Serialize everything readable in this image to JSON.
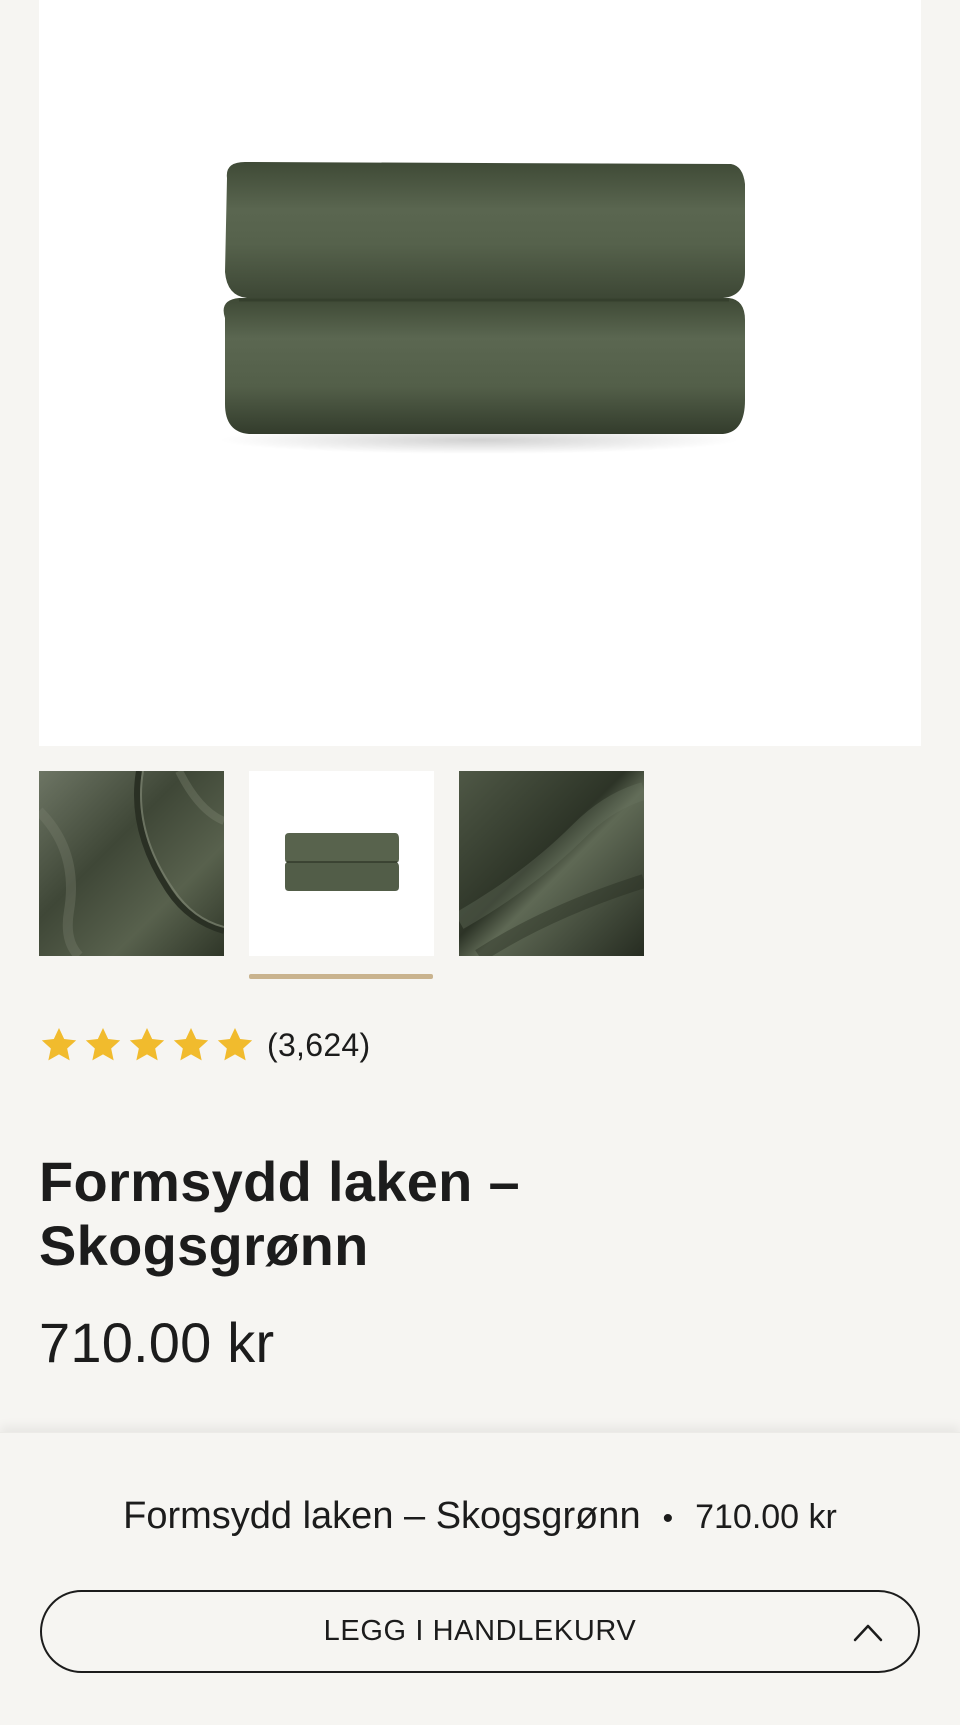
{
  "product": {
    "title": "Formsydd laken – Skogsgrønn",
    "price": "710.00 kr",
    "rating": {
      "stars": 5,
      "review_count": "(3,624)",
      "star_color": "#f1bb2d"
    },
    "color_swatch": "#4b5540"
  },
  "gallery": {
    "main_image": "folded-fitted-sheets-green",
    "thumbnails": [
      {
        "name": "fitted-sheet-corner-closeup",
        "selected": false
      },
      {
        "name": "folded-fitted-sheets",
        "selected": true
      },
      {
        "name": "fabric-closeup",
        "selected": false
      }
    ],
    "indicator_color": "#c9b38e"
  },
  "sticky_bar": {
    "title": "Formsydd laken – Skogsgrønn",
    "separator": "•",
    "price": "710.00 kr",
    "add_to_cart_label": "LEGG I HANDLEKURV",
    "toggle_icon": "chevron-up-icon"
  }
}
